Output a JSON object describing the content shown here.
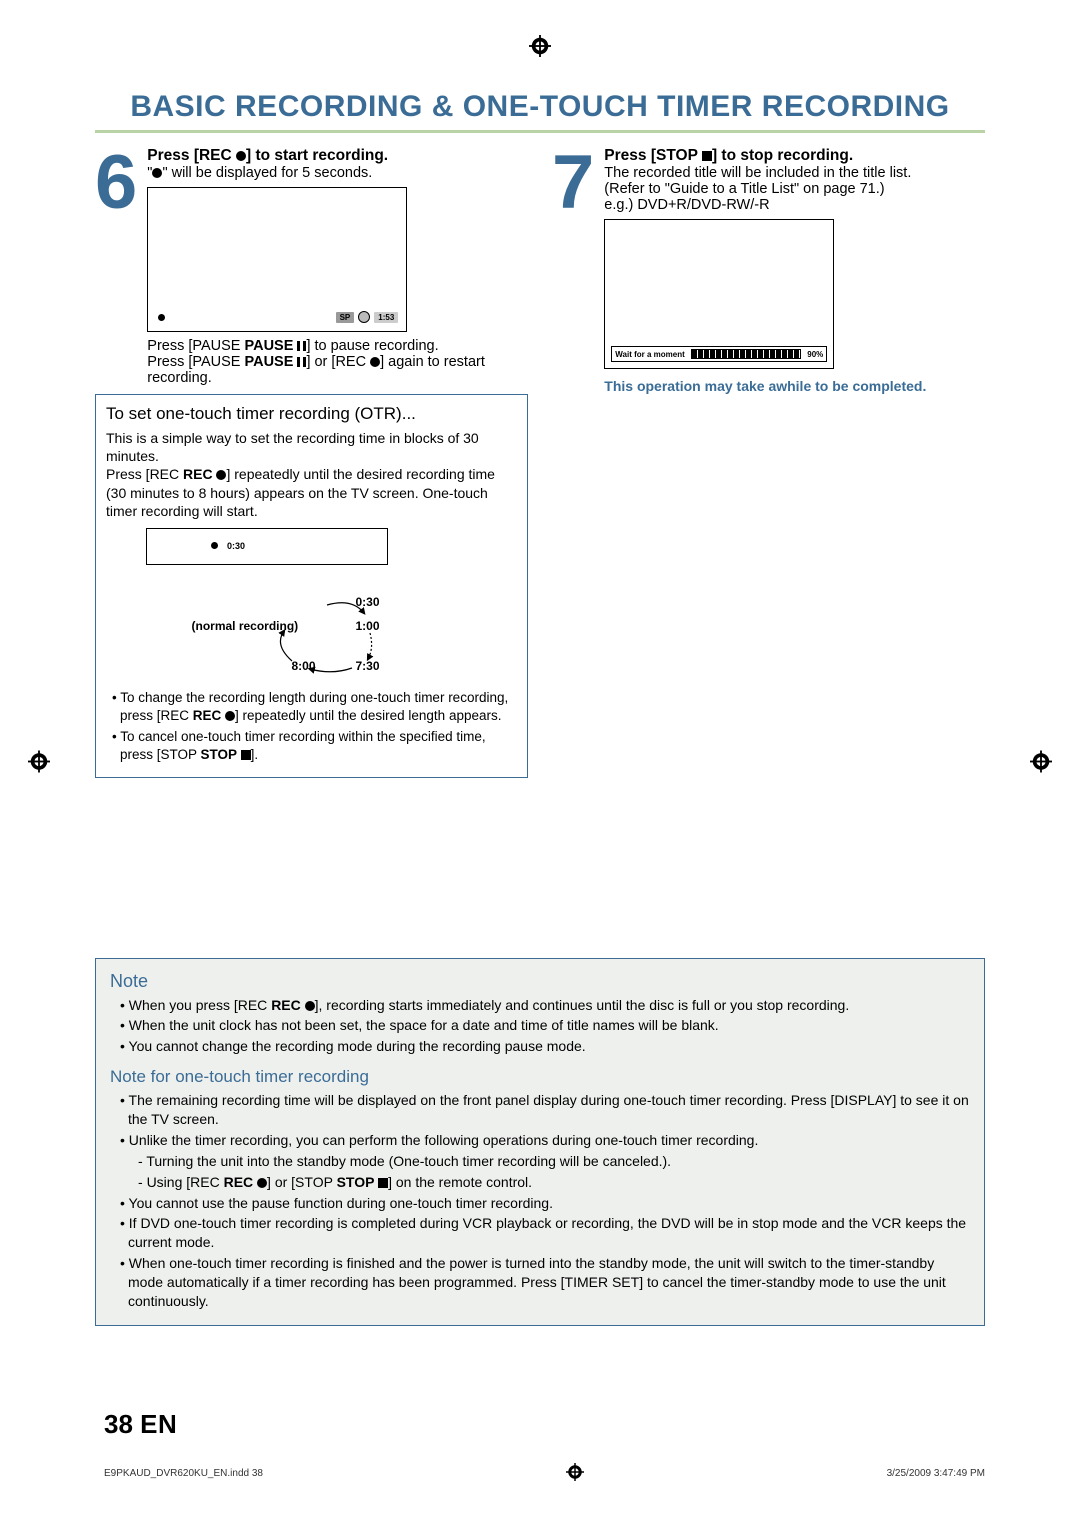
{
  "title": "BASIC RECORDING & ONE-TOUCH TIMER RECORDING",
  "step6": {
    "num": "6",
    "head_pre": "Press [REC ",
    "head_post": "] to start recording.",
    "line2_pre": "\"",
    "line2_post": "\" will be displayed for 5 seconds.",
    "sp": "SP",
    "time": "1:53",
    "pause_pre": "Press [PAUSE ",
    "pause_post": "] to pause recording.",
    "restart_pre": "Press [PAUSE ",
    "restart_mid": "] or [REC ",
    "restart_post": "] again to restart recording."
  },
  "otr": {
    "title": "To set one-touch timer recording (OTR)...",
    "p1": "This is a simple way to set the recording time in blocks of 30 minutes.",
    "p2_pre": "Press [REC ",
    "p2_post": "] repeatedly until the desired recording time (30 minutes to 8 hours) appears on the TV screen. One-touch timer recording will start.",
    "inner_time": "0:30",
    "normal": "(normal recording)",
    "t030": "0:30",
    "t100": "1:00",
    "t730": "7:30",
    "t800": "8:00",
    "b1_pre": "To change the recording length during one-touch timer recording, press [REC ",
    "b1_post": "] repeatedly until the desired length appears.",
    "b2_pre": "To cancel one-touch timer recording within the specified time, press [STOP ",
    "b2_post": "]."
  },
  "step7": {
    "num": "7",
    "head_pre": "Press [STOP ",
    "head_post": "] to stop recording.",
    "l1": "The recorded title will be included in the title list.",
    "l2": "(Refer to \"Guide to a Title List\" on page 71.)",
    "l3": "e.g.) DVD+R/DVD-RW/-R",
    "wait": "Wait for a moment",
    "pct": "90%",
    "warn": "This operation may take awhile to be completed."
  },
  "note": {
    "title": "Note",
    "n1_pre": "When you press [REC ",
    "n1_post": "], recording starts immediately and continues until the disc is full or you stop recording.",
    "n2": "When the unit clock has not been set, the space for a date and time of title names will be blank.",
    "n3": "You cannot change the recording mode during the recording pause mode.",
    "sub_title": "Note for one-touch timer recording",
    "s1": "The remaining recording time will be displayed on the front panel display during one-touch timer recording. Press [DISPLAY] to see it on the TV screen.",
    "s2": "Unlike the timer recording, you can perform the following operations during one-touch timer recording.",
    "s2a": "Turning the unit into the standby mode (One-touch timer recording will be canceled.).",
    "s2b_pre": "Using [REC ",
    "s2b_mid": "] or [STOP ",
    "s2b_post": "] on the remote control.",
    "s3": "You cannot use the pause function during one-touch timer recording.",
    "s4": "If DVD one-touch timer recording is completed during VCR playback or recording, the DVD will be in stop mode and the VCR keeps the current mode.",
    "s5": "When one-touch timer recording is finished and the power is turned into the standby mode, the unit will switch to the timer-standby mode automatically if a timer recording has been programmed. Press [TIMER SET] to cancel the timer-standby mode to use the unit continuously."
  },
  "footer": {
    "pg": "38",
    "en": "EN",
    "file": "E9PKAUD_DVR620KU_EN.indd   38",
    "date": "3/25/2009   3:47:49 PM"
  }
}
